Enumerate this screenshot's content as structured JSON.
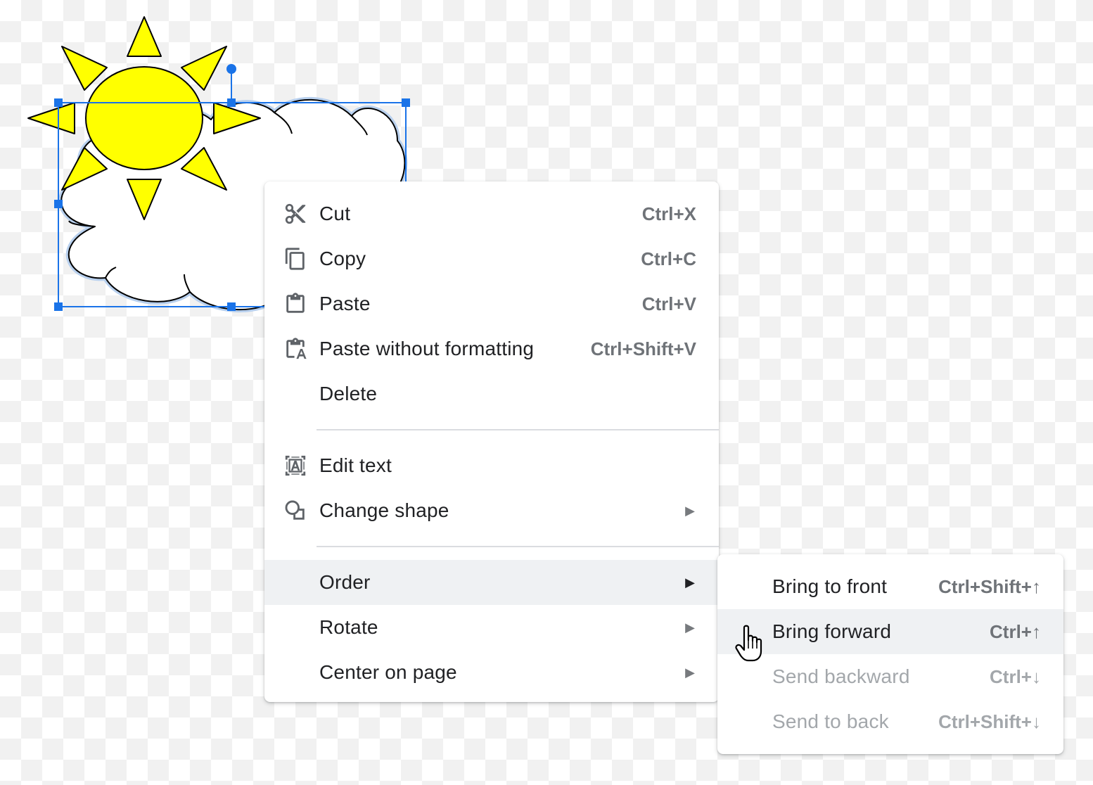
{
  "context_menu": {
    "items": [
      {
        "label": "Cut",
        "shortcut": "Ctrl+X",
        "icon": "scissors-icon"
      },
      {
        "label": "Copy",
        "shortcut": "Ctrl+C",
        "icon": "copy-icon"
      },
      {
        "label": "Paste",
        "shortcut": "Ctrl+V",
        "icon": "clipboard-icon"
      },
      {
        "label": "Paste without formatting",
        "shortcut": "Ctrl+Shift+V",
        "icon": "paste-plain-icon"
      },
      {
        "label": "Delete"
      },
      {
        "label": "Edit text",
        "icon": "edit-text-icon"
      },
      {
        "label": "Change shape",
        "icon": "change-shape-icon",
        "arrow": "▶"
      },
      {
        "label": "Order",
        "arrow": "▶"
      },
      {
        "label": "Rotate",
        "arrow": "▶"
      },
      {
        "label": "Center on page",
        "arrow": "▶"
      }
    ]
  },
  "order_submenu": {
    "items": [
      {
        "label": "Bring to front",
        "shortcut": "Ctrl+Shift+↑",
        "enabled": true
      },
      {
        "label": "Bring forward",
        "shortcut": "Ctrl+↑",
        "enabled": true
      },
      {
        "label": "Send backward",
        "shortcut": "Ctrl+↓",
        "enabled": false
      },
      {
        "label": "Send to back",
        "shortcut": "Ctrl+Shift+↓",
        "enabled": false
      }
    ]
  },
  "colors": {
    "sun_fill": "#ffff00",
    "selection": "#1a73e8",
    "highlight": "#eff1f3"
  },
  "cursor": "hand-pointer-icon"
}
